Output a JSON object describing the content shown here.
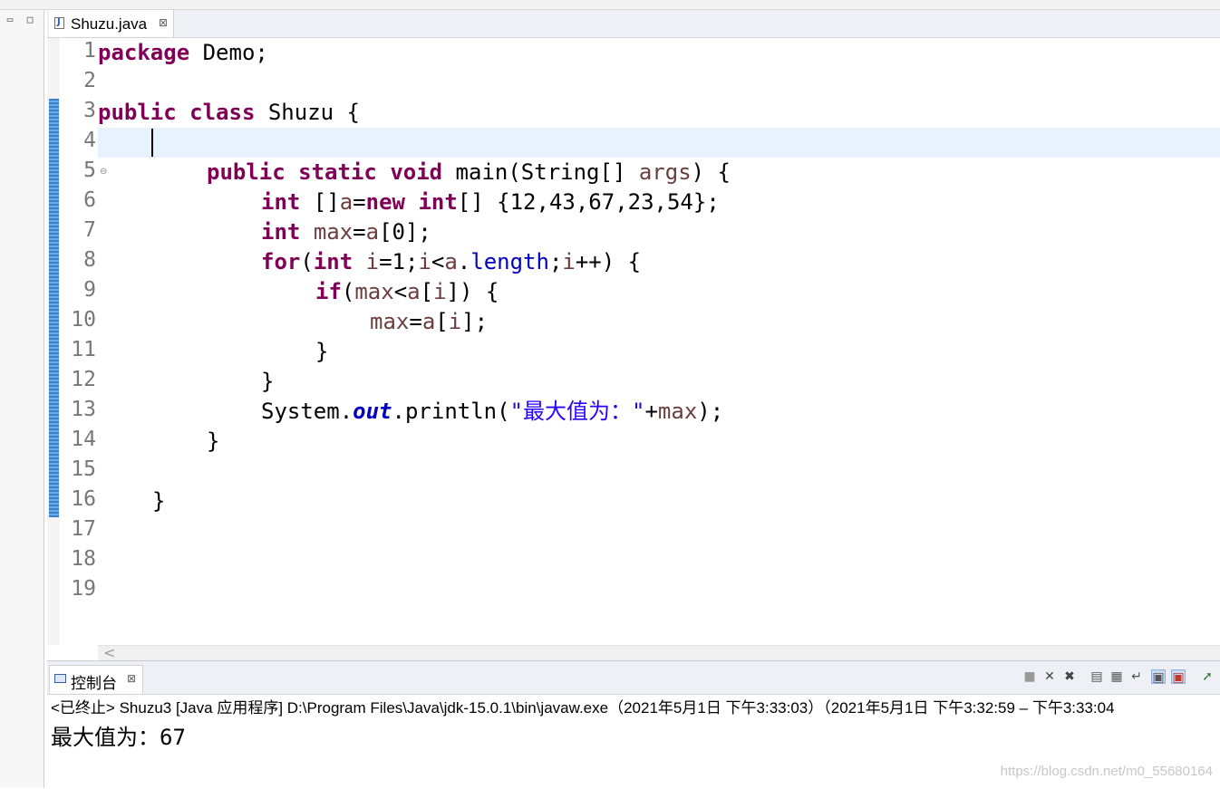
{
  "editor": {
    "tab_title": "Shuzu.java",
    "tab_icon": "java-file-icon",
    "close_glyph": "⊠",
    "lines": [
      "1",
      "2",
      "3",
      "4",
      "5",
      "6",
      "7",
      "8",
      "9",
      "10",
      "11",
      "12",
      "13",
      "14",
      "15",
      "16",
      "17",
      "18",
      "19"
    ],
    "code": {
      "l1": {
        "kw": "package",
        "rest": " Demo;"
      },
      "l3": {
        "kw1": "public",
        "kw2": "class",
        "rest": " Shuzu {"
      },
      "l5": {
        "kw1": "public",
        "kw2": "static",
        "kw3": "void",
        "t1": " main(String[] ",
        "v1": "args",
        "t2": ") {"
      },
      "l6": {
        "kw1": "int",
        "t1": " []",
        "v1": "a",
        "t2": "=",
        "kw2": "new",
        "kw3": "int",
        "t3": "[] {12,43,67,23,54};"
      },
      "l7": {
        "kw1": "int",
        "v1": "max",
        "t1": "=",
        "v2": "a",
        "t2": "[0];"
      },
      "l8": {
        "kw1": "for",
        "t1": "(",
        "kw2": "int",
        "v1": "i",
        "t2": "=1;",
        "v2": "i",
        "t3": "<",
        "v3": "a",
        "t4": ".",
        "f1": "length",
        "t5": ";",
        "v4": "i",
        "t6": "++) {"
      },
      "l9": {
        "kw1": "if",
        "t1": "(",
        "v1": "max",
        "t2": "<",
        "v2": "a",
        "t3": "[",
        "v3": "i",
        "t4": "]) {"
      },
      "l10": {
        "v1": "max",
        "t1": "=",
        "v2": "a",
        "t2": "[",
        "v3": "i",
        "t3": "];"
      },
      "l11": {
        "t1": "}"
      },
      "l12": {
        "t1": "}"
      },
      "l13": {
        "t1": "System.",
        "f1": "out",
        "t2": ".println(",
        "s1": "\"最大值为：\"",
        "t3": "+",
        "v1": "max",
        "t4": ");"
      },
      "l14": {
        "t1": "}"
      },
      "l16": {
        "t1": "}"
      }
    },
    "scroll_left_glyph": "<"
  },
  "console": {
    "tab_title": "控制台",
    "close_glyph": "⊠",
    "terminated_line": "<已终止> Shuzu3 [Java 应用程序] D:\\Program Files\\Java\\jdk-15.0.1\\bin\\javaw.exe（2021年5月1日 下午3:33:03）（2021年5月1日 下午3:32:59 – 下午3:33:04",
    "output": "最大值为：67",
    "toolbar_icons": [
      "stop-icon",
      "remove-launch-icon",
      "remove-all-launches-icon",
      "clear-console-icon",
      "scroll-lock-icon",
      "word-wrap-icon",
      "show-on-stdout-icon",
      "show-on-stderr-icon",
      "pin-console-icon"
    ]
  },
  "watermark": "https://blog.csdn.net/m0_55680164",
  "colors": {
    "keyword": "#7f0055",
    "local_variable": "#6a3e3e",
    "field": "#0000c0",
    "string": "#2a00ff",
    "current_line": "#e8f2fe"
  }
}
